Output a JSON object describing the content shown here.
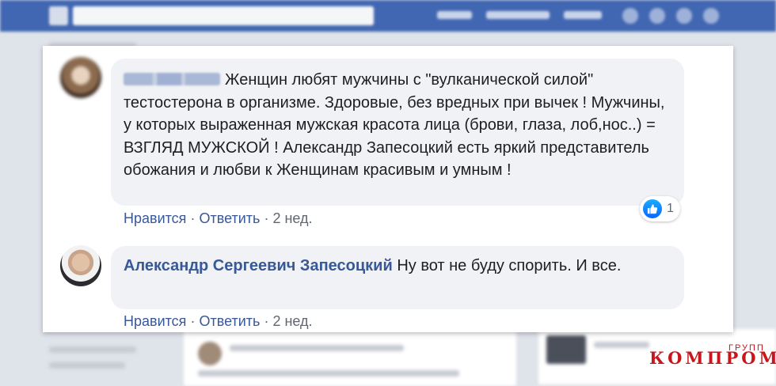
{
  "comments": [
    {
      "author": "",
      "text": "Женщин любят мужчины с \"вулканической силой\" тестостерона в организме. Здоровые, без вредных при вычек ! Мужчины, у которых выраженная мужская красота лица (брови, глаза, лоб,нос..) = ВЗГЛЯД МУЖСКОЙ ! Александр Запесоцкий есть яркий представитель обожания и любви к Женщинам красивым и умным !",
      "like_label": "Нравится",
      "reply_label": "Ответить",
      "time": "2 нед.",
      "reactions_count": "1"
    },
    {
      "author": "Александр Сергеевич Запесоцкий",
      "text": "Ну вот не буду спорить. И все.",
      "like_label": "Нравится",
      "reply_label": "Ответить",
      "time": "2 нед."
    }
  ],
  "separator": "·",
  "icons": {
    "reaction": "like-icon"
  },
  "colors": {
    "link": "#385898",
    "bubble": "#f0f2f5",
    "like": "#0866ff",
    "watermark": "#c8161d"
  },
  "watermark": {
    "main": "КОМПРОМАТ",
    "small": "ГРУПП"
  }
}
